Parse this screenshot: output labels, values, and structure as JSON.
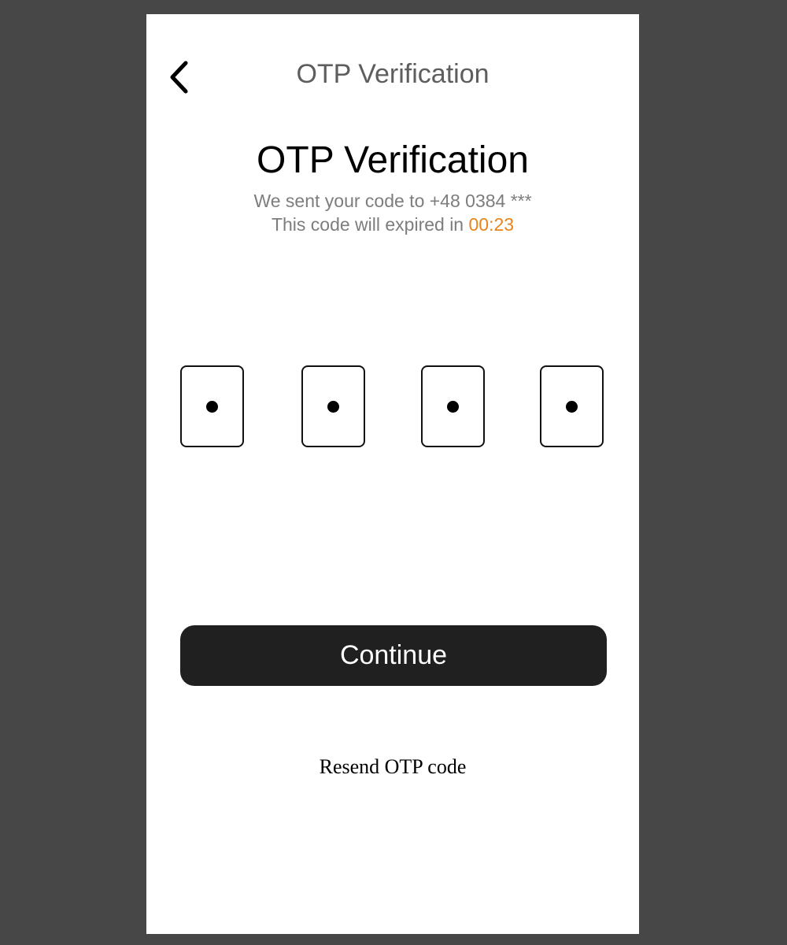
{
  "header": {
    "back_icon": "chevron-left-icon",
    "title": "OTP Verification"
  },
  "main": {
    "title": "OTP Verification",
    "sent_text": "We sent your code to +48 0384 ***",
    "expiry_prefix": "This code will expired in ",
    "timer": "00:23",
    "timer_color": "#e8841c"
  },
  "otp": {
    "digits_entered": 4,
    "mask_char": "•"
  },
  "actions": {
    "continue_label": "Continue",
    "resend_label": "Resend OTP code"
  }
}
